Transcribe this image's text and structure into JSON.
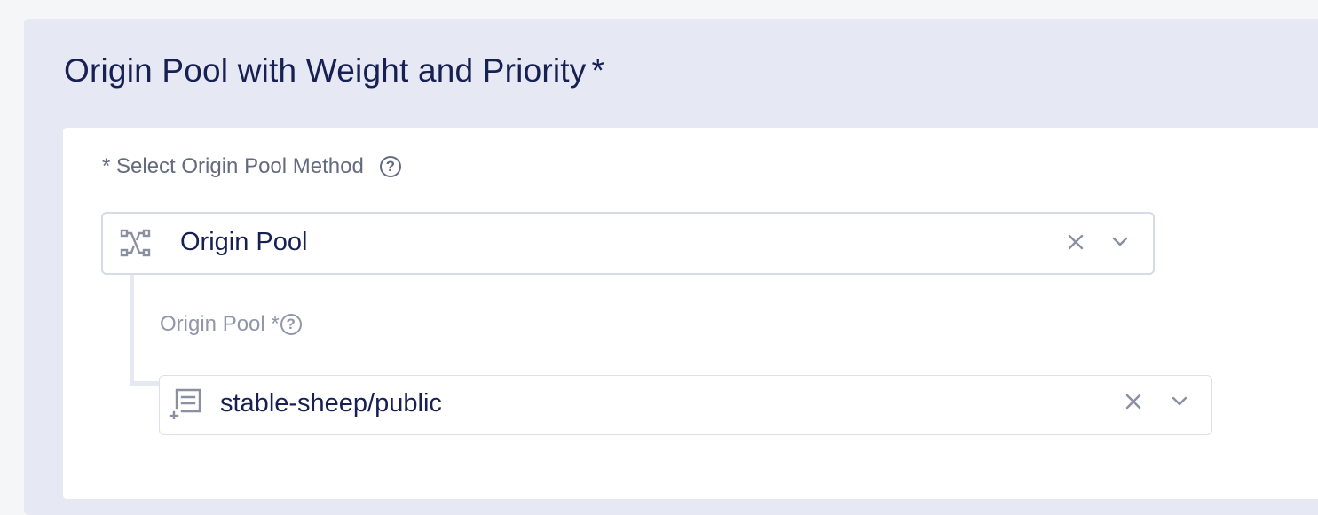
{
  "section": {
    "title": "Origin Pool with Weight and Priority",
    "required_marker": "*"
  },
  "method_field": {
    "label": "* Select Origin Pool Method",
    "help_glyph": "?",
    "value": "Origin Pool",
    "icon": "topology-icon",
    "clear_glyph": "✕",
    "chevron": "chevron-down-icon"
  },
  "pool_field": {
    "label": "Origin Pool *",
    "help_glyph": "?",
    "value": "stable-sheep/public",
    "icon": "list-add-icon",
    "clear_glyph": "✕",
    "chevron": "chevron-down-icon"
  },
  "colors": {
    "section_bg": "#e6e8f3",
    "card_bg": "#ffffff",
    "title_text": "#172052",
    "label_text": "#646b7f",
    "muted_label_text": "#9097a8",
    "icon": "#8a90a2"
  }
}
